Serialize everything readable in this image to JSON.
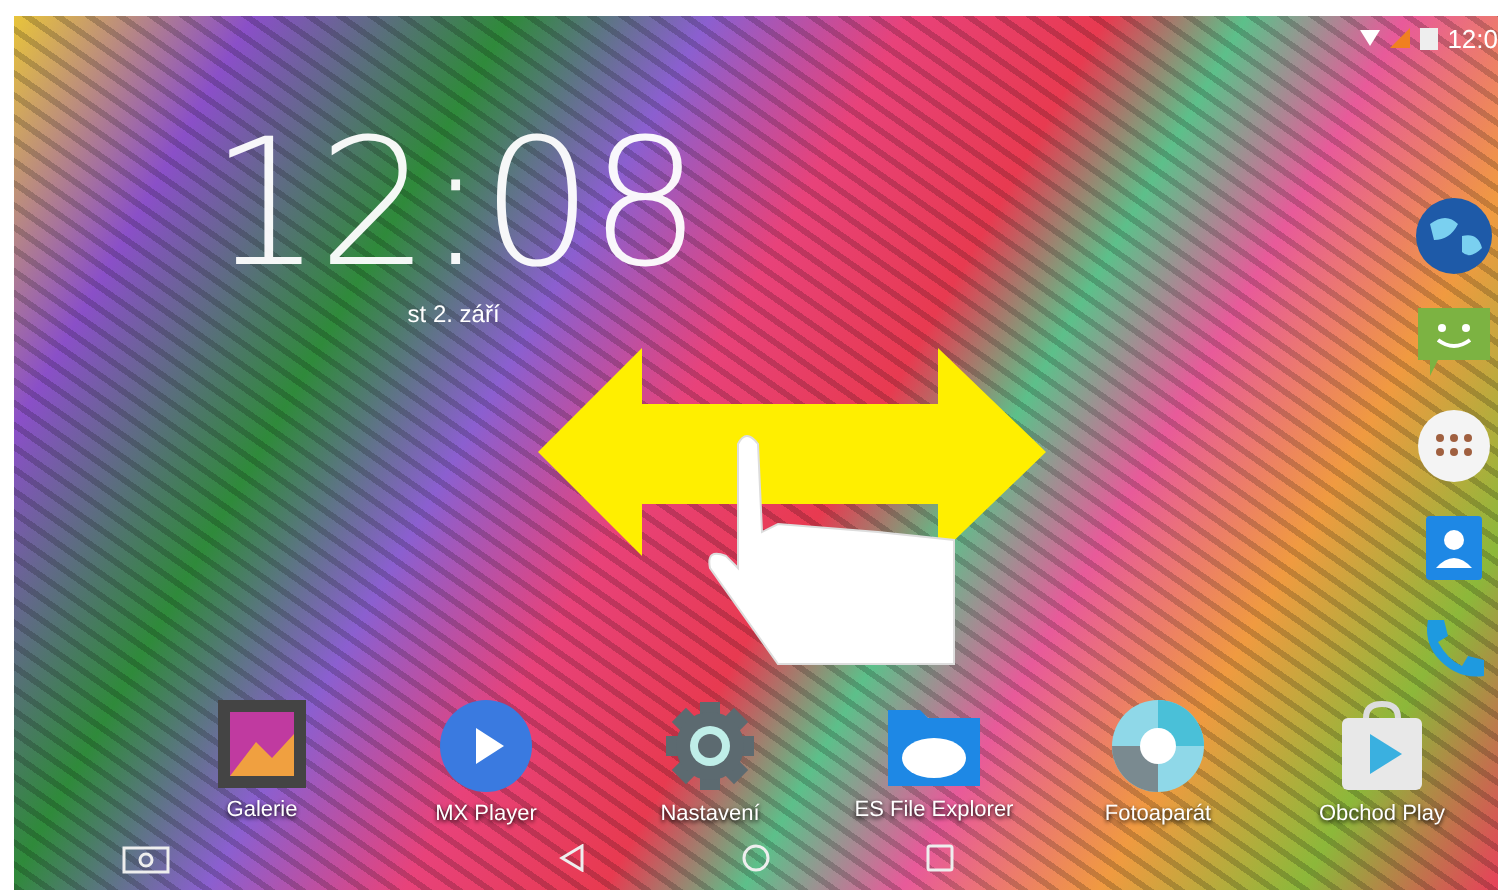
{
  "status_bar": {
    "time": "12:0"
  },
  "clock": {
    "time": "12:08",
    "date": "st 2. září"
  },
  "apps": [
    {
      "label": "Galerie"
    },
    {
      "label": "MX Player"
    },
    {
      "label": "Nastavení"
    },
    {
      "label": "ES File Explorer"
    },
    {
      "label": "Fotoaparát"
    },
    {
      "label": "Obchod Play"
    }
  ]
}
